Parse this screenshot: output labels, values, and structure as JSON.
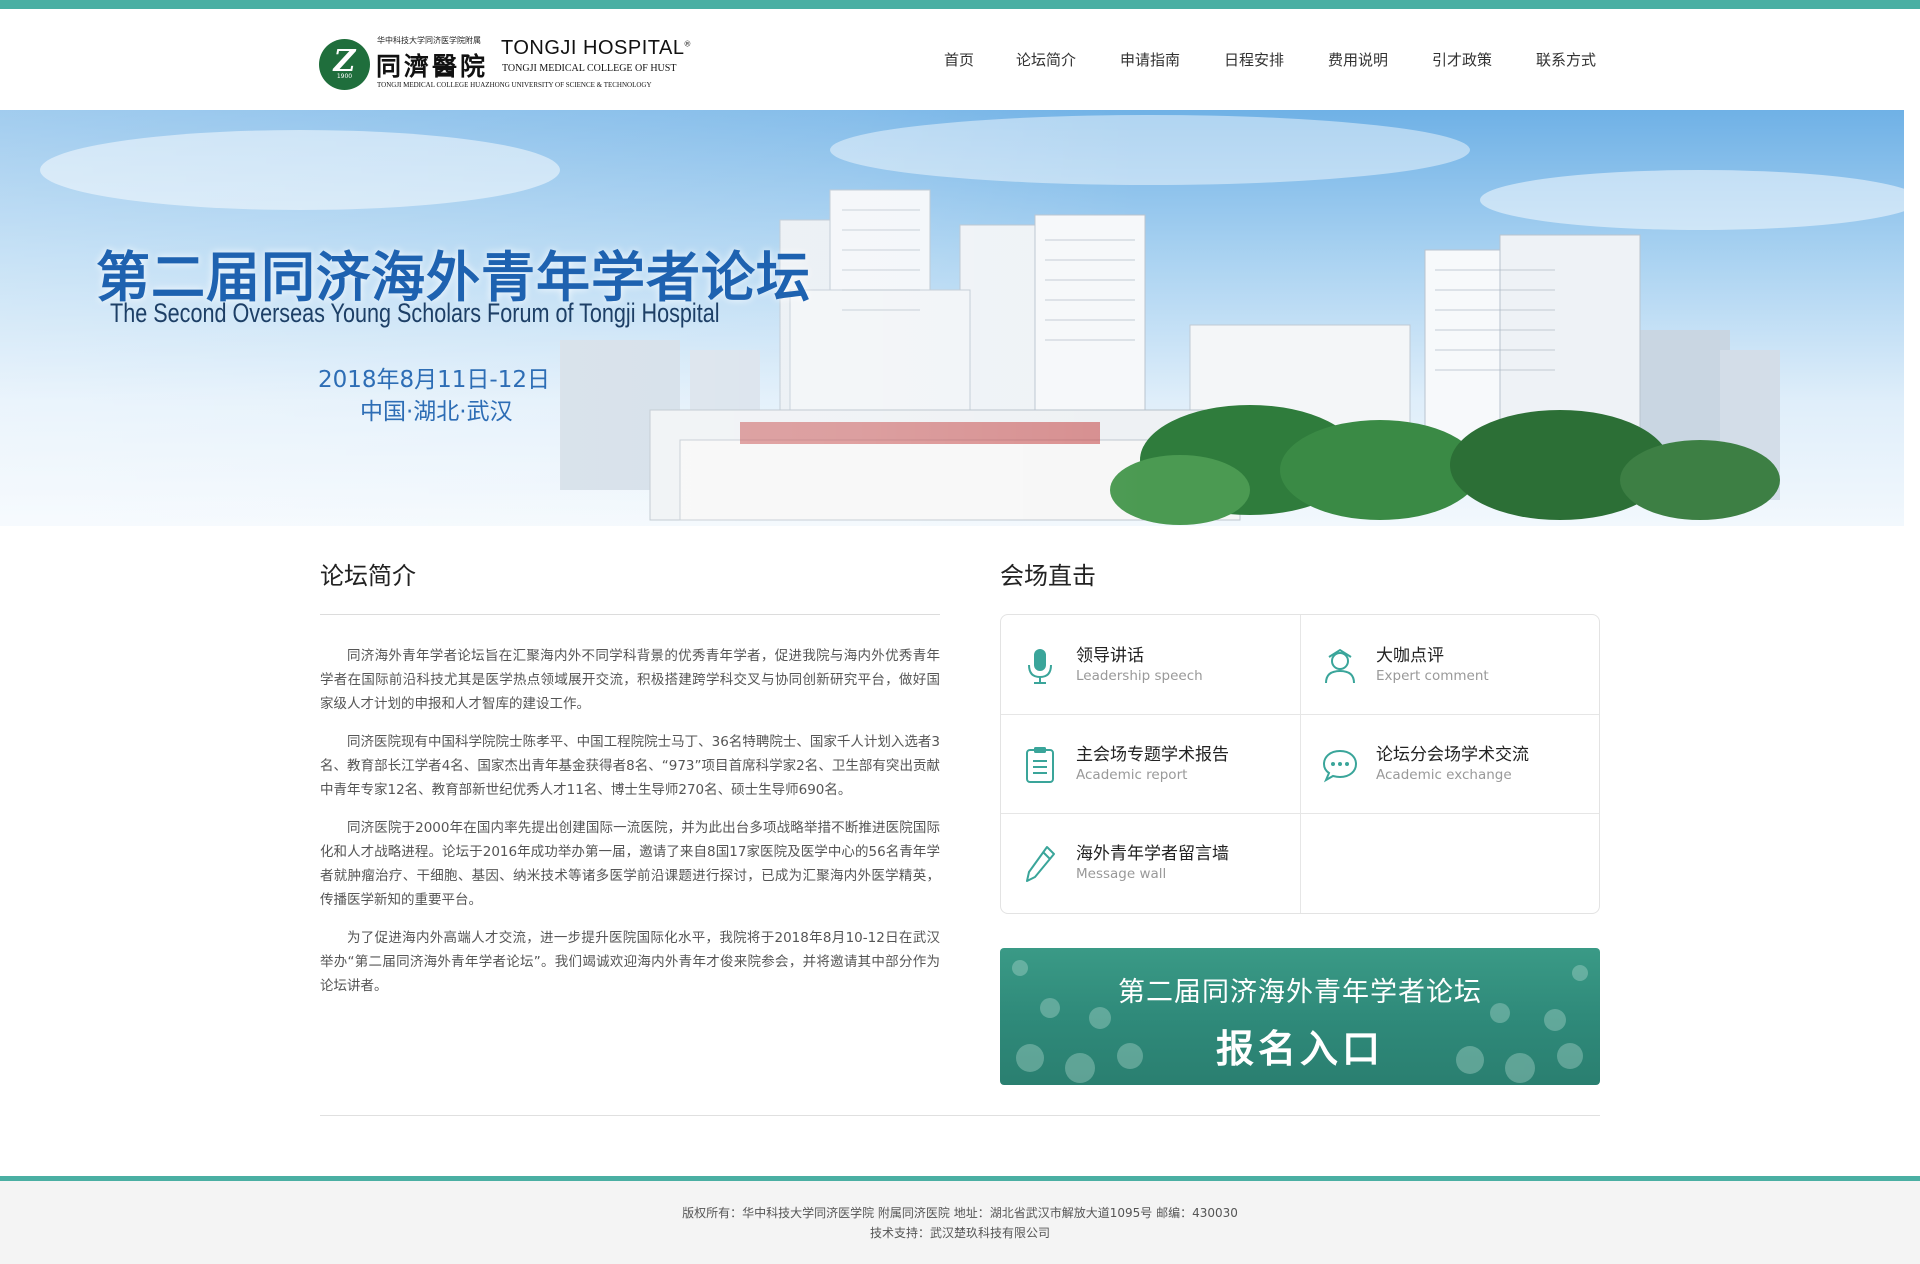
{
  "header": {
    "logo": {
      "cn_small": "华中科技大学同济医学院附属",
      "cn_big": "同濟醫院",
      "en_big": "TONGJI HOSPITAL",
      "en_mid": "TONGJI MEDICAL COLLEGE OF HUST",
      "en_small": "TONGJI MEDICAL COLLEGE HUAZHONG UNIVERSITY OF SCIENCE & TECHNOLOGY",
      "emblem_year": "1900"
    },
    "nav": [
      "首页",
      "论坛简介",
      "申请指南",
      "日程安排",
      "费用说明",
      "引才政策",
      "联系方式"
    ]
  },
  "banner": {
    "title": "第二届同济海外青年学者论坛",
    "subtitle": "The Second Overseas Young Scholars Forum of Tongji Hospital",
    "date": "2018年8月11日-12日",
    "place": "中国·湖北·武汉"
  },
  "intro": {
    "title": "论坛简介",
    "paragraphs": [
      "同济海外青年学者论坛旨在汇聚海内外不同学科背景的优秀青年学者，促进我院与海内外优秀青年学者在国际前沿科技尤其是医学热点领域展开交流，积极搭建跨学科交叉与协同创新研究平台，做好国家级人才计划的申报和人才智库的建设工作。",
      "同济医院现有中国科学院院士陈孝平、中国工程院院士马丁、36名特聘院士、国家千人计划入选者3名、教育部长江学者4名、国家杰出青年基金获得者8名、“973”项目首席科学家2名、卫生部有突出贡献中青年专家12名、教育部新世纪优秀人才11名、博士生导师270名、硕士生导师690名。",
      "同济医院于2000年在国内率先提出创建国际一流医院，并为此出台多项战略举措不断推进医院国际化和人才战略进程。论坛于2016年成功举办第一届，邀请了来自8国17家医院及医学中心的56名青年学者就肿瘤治疗、干细胞、基因、纳米技术等诸多医学前沿课题进行探讨，已成为汇聚海内外医学精英，传播医学新知的重要平台。",
      "为了促进海内外高端人才交流，进一步提升医院国际化水平，我院将于2018年8月10-12日在武汉举办“第二届同济海外青年学者论坛”。我们竭诚欢迎海内外青年才俊来院参会，并将邀请其中部分作为论坛讲者。"
    ]
  },
  "venue": {
    "title": "会场直击",
    "items": [
      {
        "cn": "领导讲话",
        "en": "Leadership speech",
        "icon": "microphone-icon"
      },
      {
        "cn": "大咖点评",
        "en": "Expert comment",
        "icon": "expert-icon"
      },
      {
        "cn": "主会场专题学术报告",
        "en": "Academic report",
        "icon": "clipboard-icon"
      },
      {
        "cn": "论坛分会场学术交流",
        "en": "Academic exchange",
        "icon": "chat-bubble-icon"
      },
      {
        "cn": "海外青年学者留言墙",
        "en": "Message wall",
        "icon": "pencil-icon"
      }
    ],
    "signup": {
      "line1": "第二届同济海外青年学者论坛",
      "line2": "报名入口"
    }
  },
  "footer": {
    "line1": "版权所有：华中科技大学同济医学院 附属同济医院 地址：湖北省武汉市解放大道1095号 邮编：430030",
    "line2": "技术支持：武汉楚玖科技有限公司"
  },
  "colors": {
    "accent": "#4aafa3",
    "banner_title": "#1e62b0",
    "signup_bg": "#2f8a7a",
    "icon": "#3aa59a"
  }
}
